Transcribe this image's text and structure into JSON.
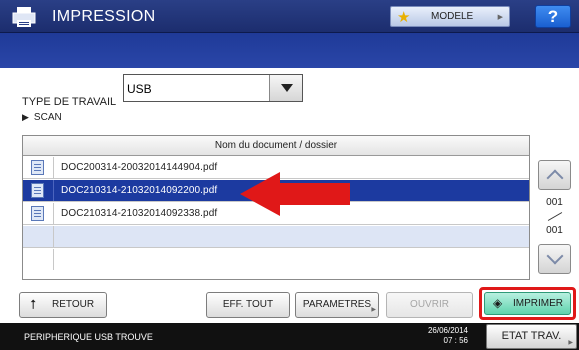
{
  "header": {
    "title": "IMPRESSION",
    "modele_label": "MODELE",
    "help_label": "?"
  },
  "filter": {
    "type_label": "TYPE DE TRAVAIL",
    "type_value": "USB",
    "folder_label": "SCAN"
  },
  "table": {
    "column_header": "Nom du document / dossier",
    "rows": [
      {
        "name": "DOC200314-20032014144904.pdf",
        "selected": false
      },
      {
        "name": "DOC210314-21032014092200.pdf",
        "selected": true
      },
      {
        "name": "DOC210314-21032014092338.pdf",
        "selected": false
      }
    ]
  },
  "pager": {
    "current": "001",
    "total": "001"
  },
  "buttons": {
    "retour": "RETOUR",
    "eff_tout": "EFF. TOUT",
    "parametres": "PARAMETRES",
    "ouvrir": "OUVRIR",
    "imprimer": "IMPRIMER",
    "etat_trav": "ETAT TRAV."
  },
  "status": {
    "message": "PERIPHERIQUE USB TROUVE",
    "date": "26/06/2014",
    "time": "07 : 56"
  },
  "colors": {
    "title_bar": "#1c2d6e",
    "selection": "#1c3aa0",
    "highlight_arrow": "#e01818",
    "print_button": "#5fd3ad"
  }
}
